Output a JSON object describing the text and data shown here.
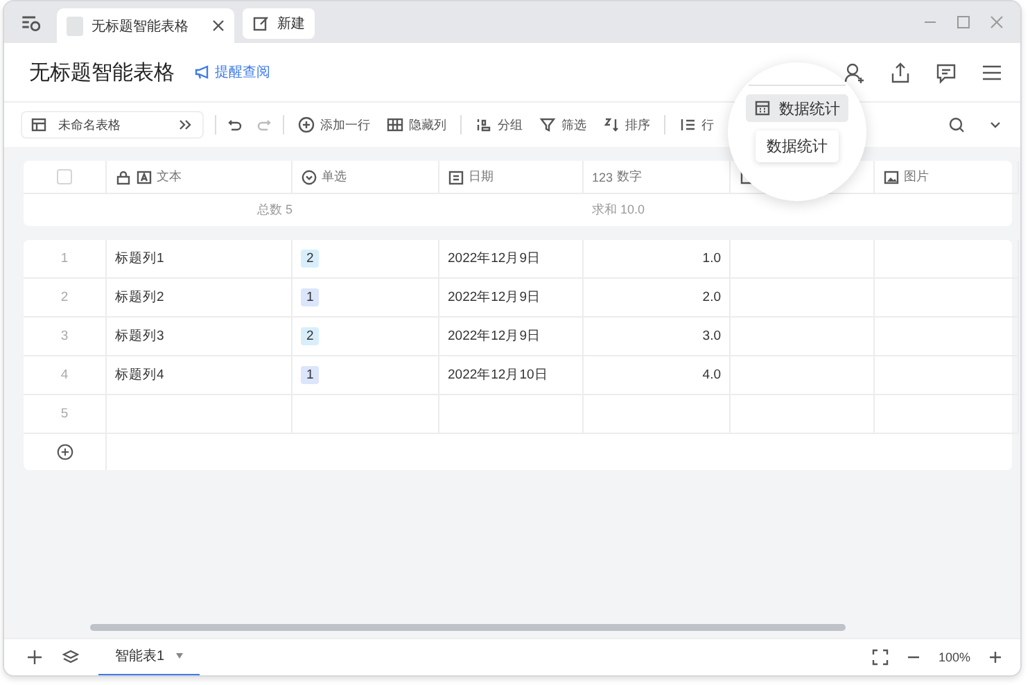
{
  "tabs": [
    {
      "label": "无标题智能表格",
      "selected": true
    },
    {
      "label": "新建",
      "selected": false
    }
  ],
  "document": {
    "title": "无标题智能表格",
    "remind_link": "提醒查阅"
  },
  "toolbar": {
    "sheet_selector": "未命名表格",
    "items": [
      {
        "kind": "add-row",
        "label": "添加一行"
      },
      {
        "kind": "hide",
        "label": "隐藏列"
      },
      {
        "kind": "group",
        "label": "分组"
      },
      {
        "kind": "filter",
        "label": "筛选"
      },
      {
        "kind": "sort",
        "label": "排序"
      },
      {
        "kind": "height",
        "label": "行"
      }
    ]
  },
  "magnifier": {
    "button": "数据统计",
    "tooltip": "数据统计"
  },
  "table": {
    "select_all": {
      "checked": false
    },
    "columns": [
      {
        "kind": "text",
        "label": "文本"
      },
      {
        "kind": "select",
        "label": "单选"
      },
      {
        "kind": "date",
        "label": "日期"
      },
      {
        "kind": "number",
        "icon_text": "123",
        "label": "数字"
      },
      {
        "kind": "other"
      },
      {
        "kind": "image",
        "label": "图片"
      }
    ],
    "summary": {
      "text_column": "总数 5",
      "number_column": "求和 10.0"
    },
    "rows": [
      {
        "number": "1",
        "cells": [
          "标题列1",
          {
            "tag": "2",
            "color": "#d8effb"
          },
          "2022年12月9日",
          "1.0"
        ]
      },
      {
        "number": "2",
        "cells": [
          "标题列2",
          {
            "tag": "1",
            "color": "#dbe5fb"
          },
          "2022年12月9日",
          "2.0"
        ]
      },
      {
        "number": "3",
        "cells": [
          "标题列3",
          {
            "tag": "2",
            "color": "#d8effb"
          },
          "2022年12月9日",
          "3.0"
        ]
      },
      {
        "number": "4",
        "cells": [
          "标题列4",
          {
            "tag": "1",
            "color": "#dbe5fb"
          },
          "2022年12月10日",
          "4.0"
        ]
      },
      {
        "number": "5",
        "cells": []
      }
    ]
  },
  "sheets": [
    {
      "label": "智能表1",
      "selected": true
    }
  ],
  "zoom": "100%"
}
